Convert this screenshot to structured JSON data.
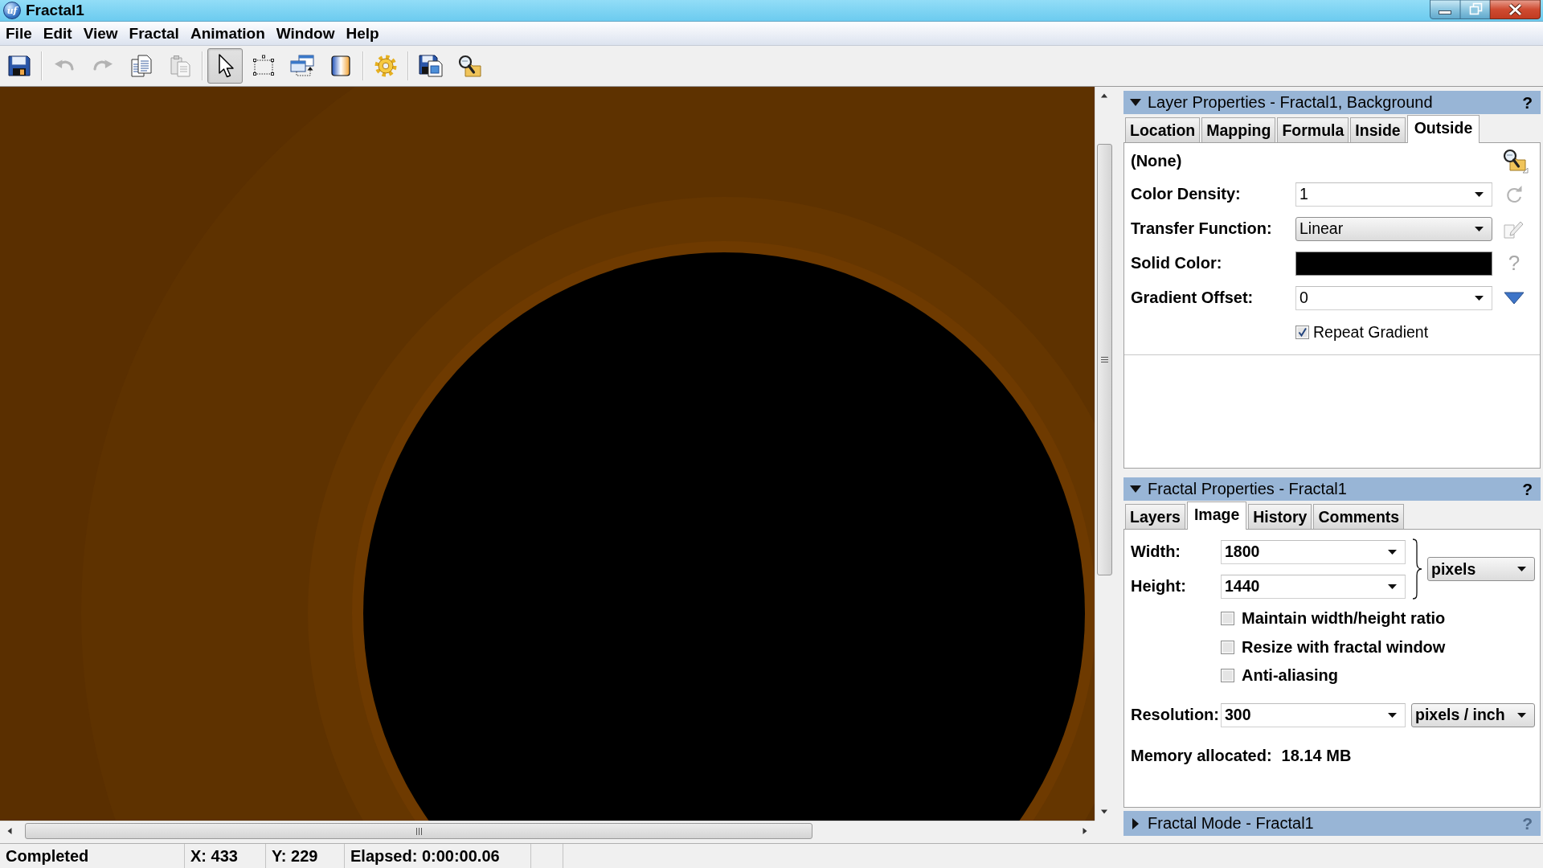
{
  "window": {
    "icon_label": "uf",
    "title": "Fractal1"
  },
  "menu": [
    {
      "label": "File"
    },
    {
      "label": "Edit"
    },
    {
      "label": "View"
    },
    {
      "label": "Fractal"
    },
    {
      "label": "Animation"
    },
    {
      "label": "Window"
    },
    {
      "label": "Help"
    }
  ],
  "toolbar": [
    {
      "kind": "button",
      "disabled": false,
      "selected": false
    },
    {
      "kind": "separator"
    },
    {
      "kind": "button",
      "disabled": true,
      "selected": false
    },
    {
      "kind": "button",
      "disabled": true,
      "selected": false
    },
    {
      "kind": "button",
      "disabled": false,
      "selected": false
    },
    {
      "kind": "button",
      "disabled": true,
      "selected": false
    },
    {
      "kind": "separator"
    },
    {
      "kind": "button",
      "disabled": false,
      "selected": true
    },
    {
      "kind": "button",
      "disabled": false,
      "selected": false
    },
    {
      "kind": "button",
      "disabled": false,
      "selected": false
    },
    {
      "kind": "button",
      "disabled": false,
      "selected": false
    },
    {
      "kind": "separator"
    },
    {
      "kind": "button",
      "disabled": false,
      "selected": false
    },
    {
      "kind": "separator"
    },
    {
      "kind": "button",
      "disabled": false,
      "selected": false
    },
    {
      "kind": "button",
      "disabled": false,
      "selected": false
    }
  ],
  "layer_properties": {
    "expanded": true,
    "title": "Layer Properties - Fractal1, Background",
    "help": {
      "label": "?",
      "disabled": false
    },
    "tabs": [
      {
        "label": "Location",
        "selected": false
      },
      {
        "label": "Mapping",
        "selected": false
      },
      {
        "label": "Formula",
        "selected": false
      },
      {
        "label": "Inside",
        "selected": false
      },
      {
        "label": "Outside",
        "selected": true
      }
    ],
    "formula_name": "(None)",
    "rows": [
      {
        "kind": "combo",
        "label": "Color Density:",
        "value": "1"
      },
      {
        "kind": "select",
        "label": "Transfer Function:",
        "value": "Linear"
      },
      {
        "kind": "color",
        "label": "Solid Color:",
        "color": "#000000",
        "side_text": "?"
      },
      {
        "kind": "combo",
        "label": "Gradient Offset:",
        "value": "0"
      },
      {
        "kind": "checkbox",
        "label": "Repeat Gradient",
        "checked": true
      }
    ]
  },
  "fractal_properties": {
    "expanded": true,
    "title": "Fractal Properties - Fractal1",
    "help": {
      "label": "?",
      "disabled": false
    },
    "tabs": [
      {
        "label": "Layers",
        "selected": false
      },
      {
        "label": "Image",
        "selected": true
      },
      {
        "label": "History",
        "selected": false
      },
      {
        "label": "Comments",
        "selected": false
      }
    ],
    "width": {
      "label": "Width:",
      "value": "1800"
    },
    "height": {
      "label": "Height:",
      "value": "1440"
    },
    "size_unit": "pixels",
    "options": [
      {
        "label": "Maintain width/height ratio",
        "checked": false
      },
      {
        "label": "Resize with fractal window",
        "checked": false
      },
      {
        "label": "Anti-aliasing",
        "checked": false
      }
    ],
    "resolution": {
      "label": "Resolution:",
      "value": "300",
      "unit": "pixels / inch"
    },
    "memory": {
      "label": "Memory allocated:",
      "value": "18.14 MB"
    }
  },
  "fractal_mode": {
    "expanded": false,
    "title": "Fractal Mode - Fractal1",
    "help": {
      "label": "?",
      "disabled": true
    }
  },
  "status_bar": [
    "Completed",
    "X: 433",
    "Y: 229",
    "Elapsed: 0:00:00.06"
  ]
}
